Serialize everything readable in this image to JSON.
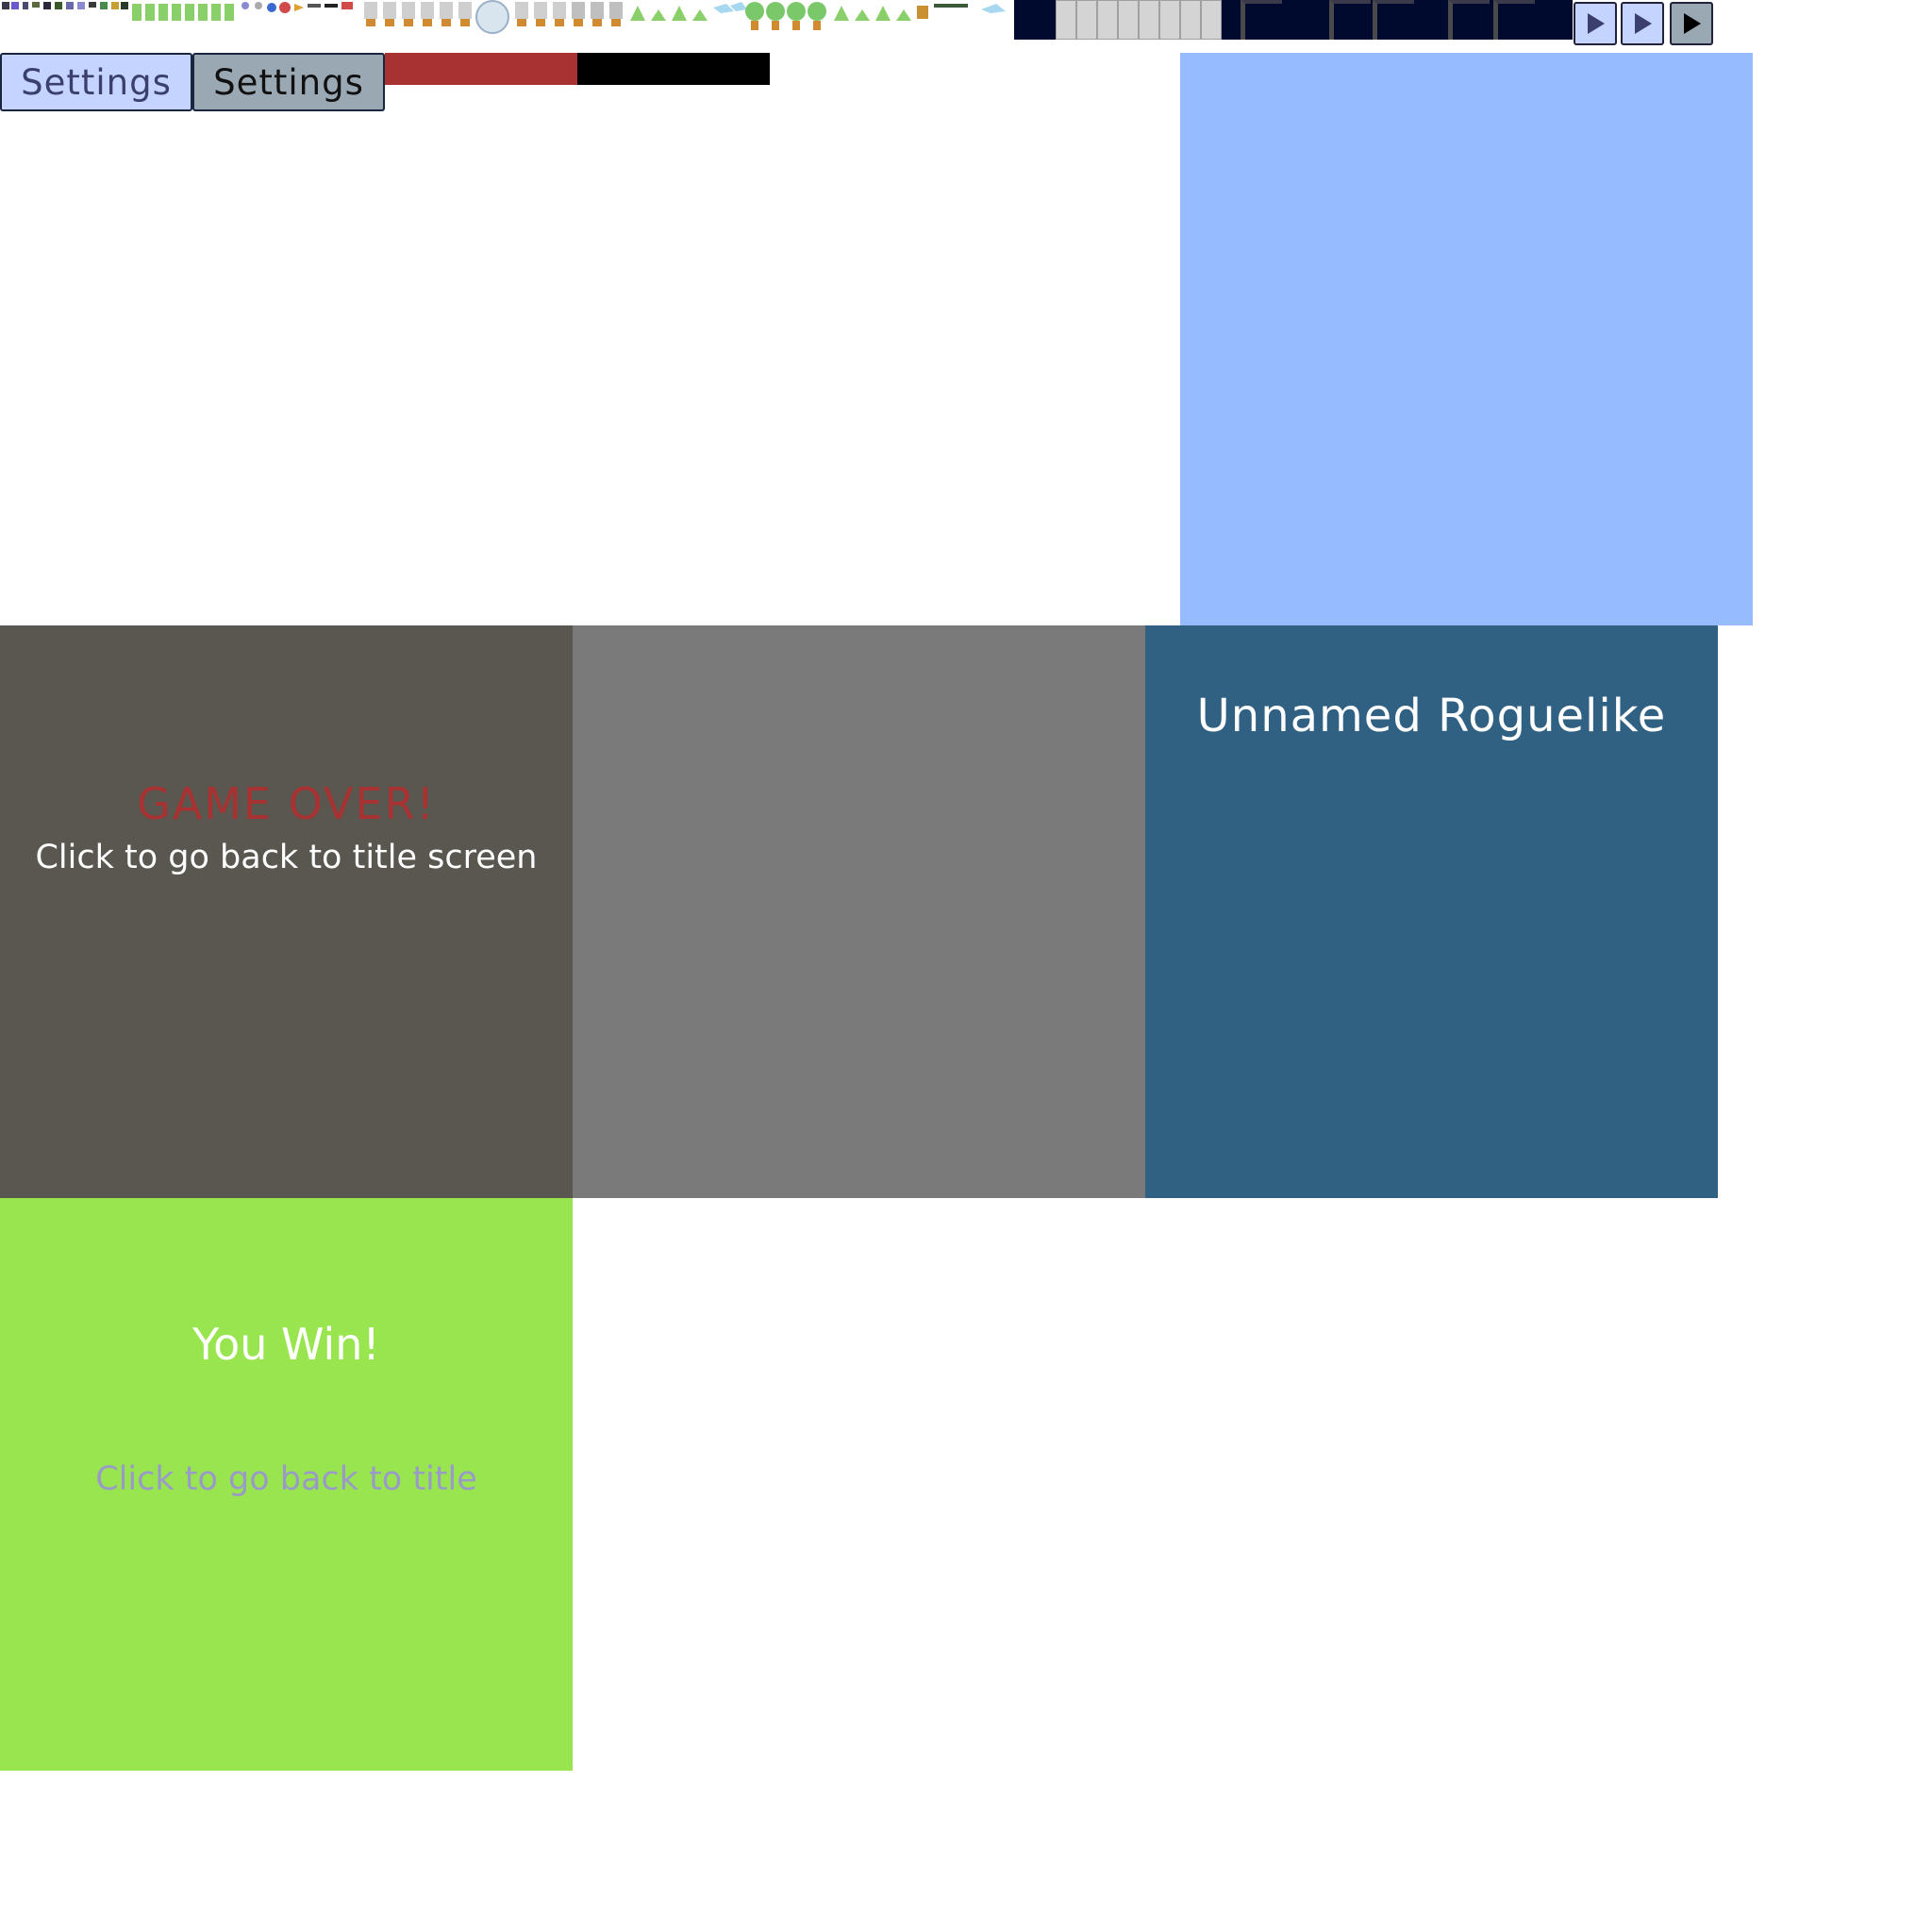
{
  "hud": {
    "settings_buttons": [
      {
        "label": "Settings",
        "state": "normal"
      },
      {
        "label": "Settings",
        "state": "pressed"
      }
    ],
    "play_buttons": [
      "play-normal",
      "play-hover",
      "play-pressed"
    ]
  },
  "screens": {
    "game_over": {
      "heading": "GAME OVER!",
      "subtitle": "Click to go back to title screen"
    },
    "title": {
      "heading": "Unnamed Roguelike"
    },
    "win": {
      "heading": "You Win!",
      "subtitle": "Click to go back to title"
    }
  },
  "colors": {
    "settings_normal_bg": "#c5d4ff",
    "settings_normal_text": "#3a3f6e",
    "settings_pressed_bg": "#9aa8b4",
    "settings_pressed_text": "#111111",
    "health_bar_fill": "#a83232",
    "health_bar_empty": "#000000",
    "blue_panel": "#96bbff",
    "game_over_bg": "#5a5750",
    "game_over_heading": "#a83232",
    "gray_panel": "#7a7a7a",
    "title_bg": "#306082",
    "win_bg": "#99e550",
    "win_subtitle": "#9a9ac8"
  }
}
